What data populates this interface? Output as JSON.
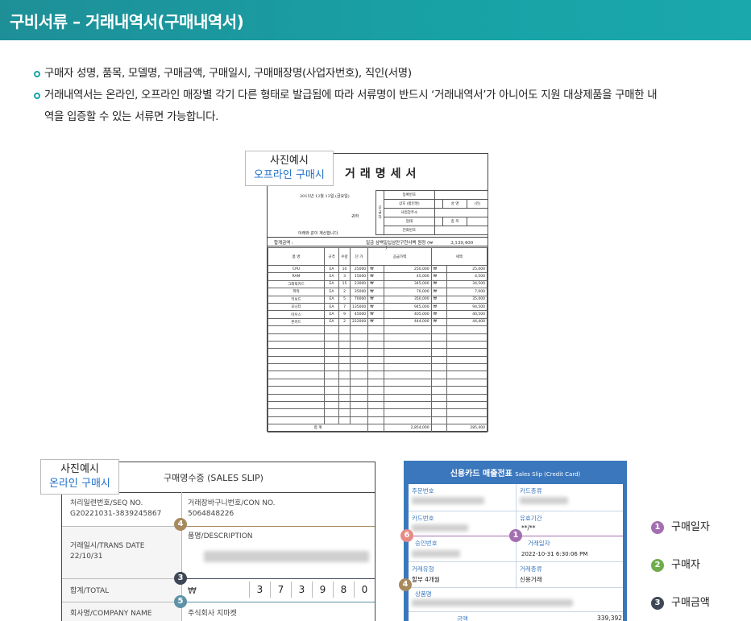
{
  "header": {
    "title": "구비서류 – 거래내역서(구매내역서)"
  },
  "bullets": [
    "구매자 성명, 품목, 모델명, 구매금액, 구매일시, 구매매장명(사업자번호), 직인(서명)",
    "거래내역서는 온라인, 오프라인 매장별 각기 다른 형태로 발급됨에 따라 서류명이 반드시 ‘거래내역서’가 아니어도 지원 대상제품을 구매한 내",
    "역을 입증할 수 있는 서류면 가능합니다."
  ],
  "offline": {
    "label1": "사진예시",
    "label2": "오프라인 구매시",
    "doc_title": "거래명세서",
    "date": "2015년 12월 13일 (금요일)",
    "recipient": "귀하",
    "note": "아래와 같이 계산합니다.",
    "supplier_label": "공급자",
    "supplier_rows": [
      [
        "등록번호",
        ""
      ],
      [
        "상호 (법인명)",
        "",
        "성 명",
        "(인)"
      ],
      [
        "사업장주소",
        ""
      ],
      [
        "업태",
        "",
        "종 목",
        ""
      ],
      [
        "전화번호",
        ""
      ]
    ],
    "total_label": "합계금액 :",
    "total_text": "일금 삼백일십삼만구천사백 원정 (₩",
    "total_value": "3,139,400",
    "total_close": ")",
    "columns": [
      "품 명",
      "규격",
      "수량",
      "단 가",
      "공급가액",
      "세액"
    ],
    "rows": [
      [
        "CPU",
        "EA",
        "10",
        "25000",
        "₩",
        "250,000",
        "₩",
        "25,000"
      ],
      [
        "RAM",
        "EA",
        "3",
        "15000",
        "₩",
        "45,000",
        "₩",
        "4,500"
      ],
      [
        "그래픽카드",
        "EA",
        "15",
        "23000",
        "₩",
        "345,000",
        "₩",
        "34,500"
      ],
      [
        "파워",
        "EA",
        "2",
        "35000",
        "₩",
        "70,000",
        "₩",
        "7,000"
      ],
      [
        "키보드",
        "EA",
        "5",
        "70000",
        "₩",
        "350,000",
        "₩",
        "35,000"
      ],
      [
        "모니터",
        "EA",
        "7",
        "135000",
        "₩",
        "945,000",
        "₩",
        "94,500"
      ],
      [
        "마우스",
        "EA",
        "9",
        "45000",
        "₩",
        "405,000",
        "₩",
        "40,500"
      ],
      [
        "본카드",
        "EA",
        "2",
        "222000",
        "₩",
        "444,000",
        "₩",
        "44,400"
      ]
    ],
    "sum_label": "합 계",
    "sum_supply": "2,854,000",
    "sum_tax": "285,400"
  },
  "online": {
    "label1": "사진예시",
    "label2": "온라인 구매시",
    "slip_title": "구매영수증 (SALES SLIP)",
    "seq_label": "처리일련번호/SEQ NO.",
    "seq_value": "G20221031-3839245867",
    "con_label": "거래장바구니번호/CON NO.",
    "con_value": "5064848226",
    "trans_label": "거래일시/TRANS DATE",
    "trans_value": "22/10/31",
    "desc_label": "품명/DESCRIPTION",
    "total_label": "합계/TOTAL",
    "won": "₩",
    "digits": [
      "3",
      "7",
      "3",
      "9",
      "8",
      "0"
    ],
    "company_label": "회사명/COMPANY NAME",
    "company_value": "주식회사 지마켓"
  },
  "card": {
    "title": "신용카드 매출전표",
    "subtitle": "Sales Slip (Credit Card)",
    "fields": {
      "buyer": "주문번호",
      "card_type": "카드종류",
      "card_no": "카드번호",
      "valid": "유효기간",
      "valid_value": "**/**",
      "approval": "승인번호",
      "trans_date": "거래일자",
      "trans_date_value": "2022-10-31 6:30:06 PM",
      "trans_kind": "거래유형",
      "trans_kind_value": "할부 4개월",
      "trans_type": "거래종류",
      "trans_type_value": "신용거래",
      "product": "상품명",
      "amount": "금액",
      "amount_value": "339,392"
    }
  },
  "badges": {
    "b1": "1",
    "b2": "2",
    "b3": "3",
    "b4": "4",
    "b5": "5",
    "b6": "6"
  },
  "legend": [
    {
      "num": "1",
      "label": "구매일자",
      "color": "#a46fb0"
    },
    {
      "num": "2",
      "label": "구매자",
      "color": "#6fad4c"
    },
    {
      "num": "3",
      "label": "구매금액",
      "color": "#3d4756"
    }
  ],
  "colors": {
    "b1": "#a46fb0",
    "b2": "#6fad4c",
    "b3": "#3d4756",
    "b4": "#a8895d",
    "b5": "#5e92a8",
    "b6": "#e58a86"
  }
}
